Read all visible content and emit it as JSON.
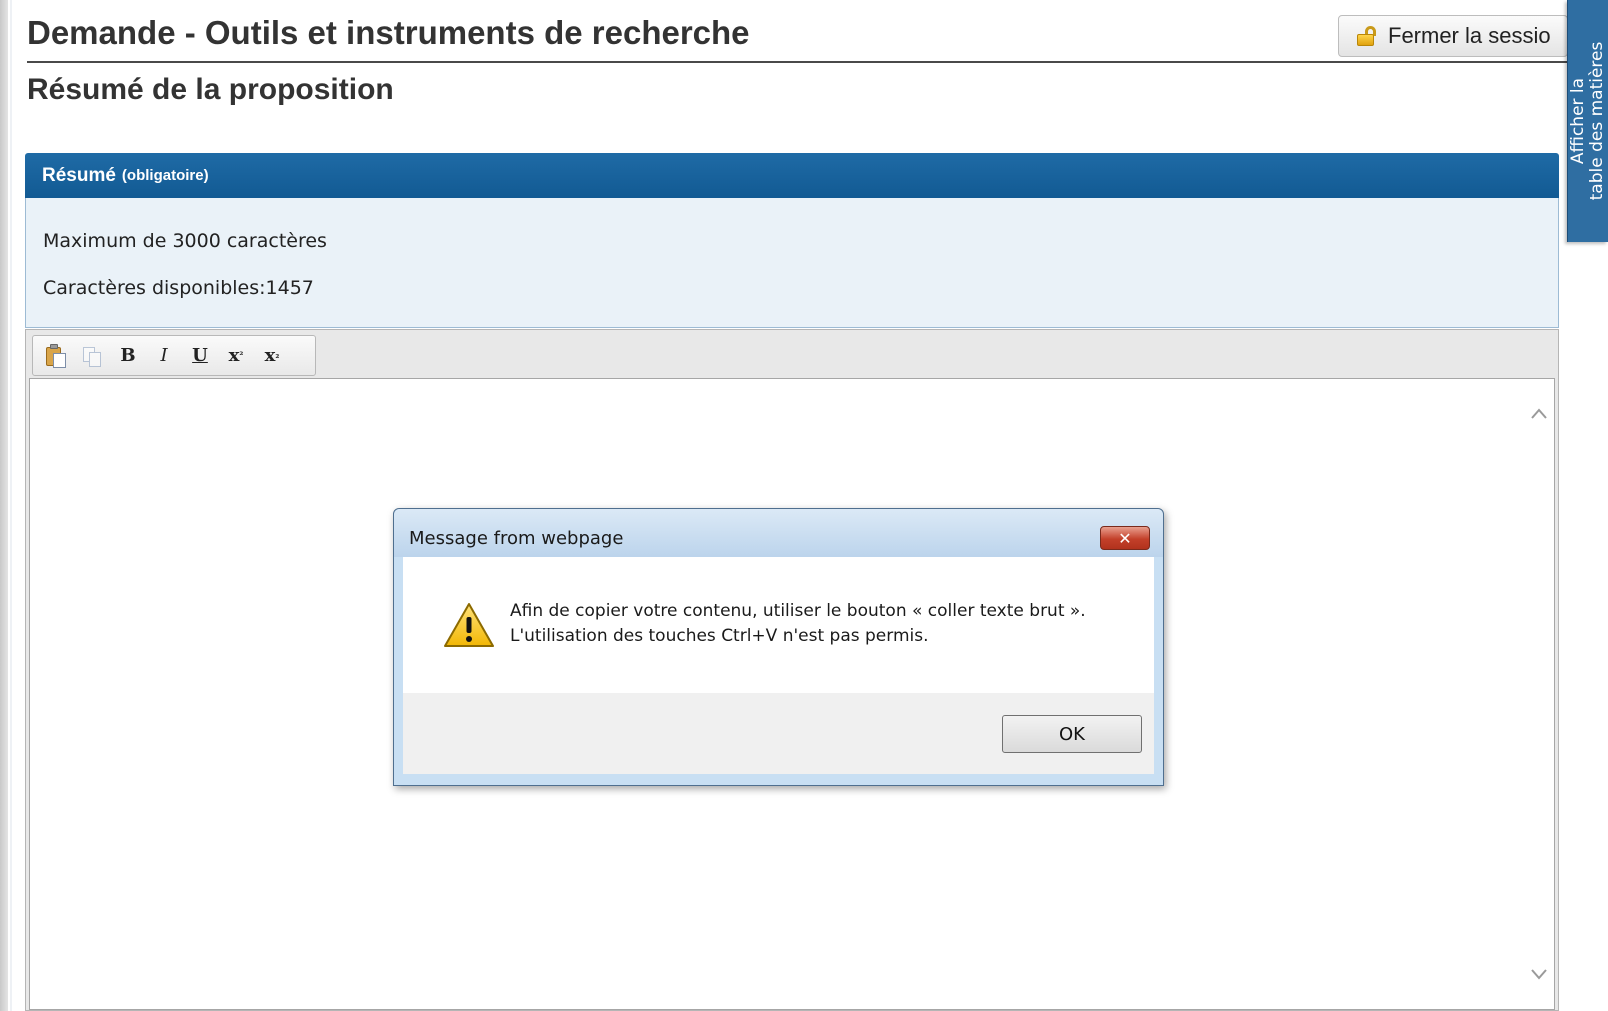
{
  "header": {
    "title": "Demande - Outils et instruments de recherche",
    "logout_label": "Fermer la sessio"
  },
  "toc_tab": {
    "line1": "Afficher la",
    "line2": "table des matières"
  },
  "section": {
    "title": "Résumé de la proposition"
  },
  "panel": {
    "title": "Résumé",
    "required": "(obligatoire)",
    "max_chars": "Maximum de 3000 caractères",
    "available_chars": "Caractères disponibles:1457"
  },
  "toolbar": {
    "bold": "B",
    "italic": "I",
    "underline": "U",
    "superscript_base": "x",
    "superscript_mark": "²",
    "subscript_base": "x",
    "subscript_mark": "₂"
  },
  "dialog": {
    "title": "Message from webpage",
    "close_label": "✕",
    "message_line1": "Afin de copier votre contenu, utiliser le bouton « coller texte brut ».",
    "message_line2": "L'utilisation des touches Ctrl+V n'est pas permis.",
    "ok_label": "OK"
  },
  "icons": [
    "lock-icon",
    "paste-icon",
    "copy-icon",
    "warning-icon",
    "close-icon",
    "chevron-up-icon",
    "chevron-down-icon"
  ],
  "colors": {
    "header_blue": "#1f6ba6",
    "toc_blue": "#2f6ea2",
    "info_bg": "#eaf2f8",
    "warning_yellow": "#f6c417"
  }
}
